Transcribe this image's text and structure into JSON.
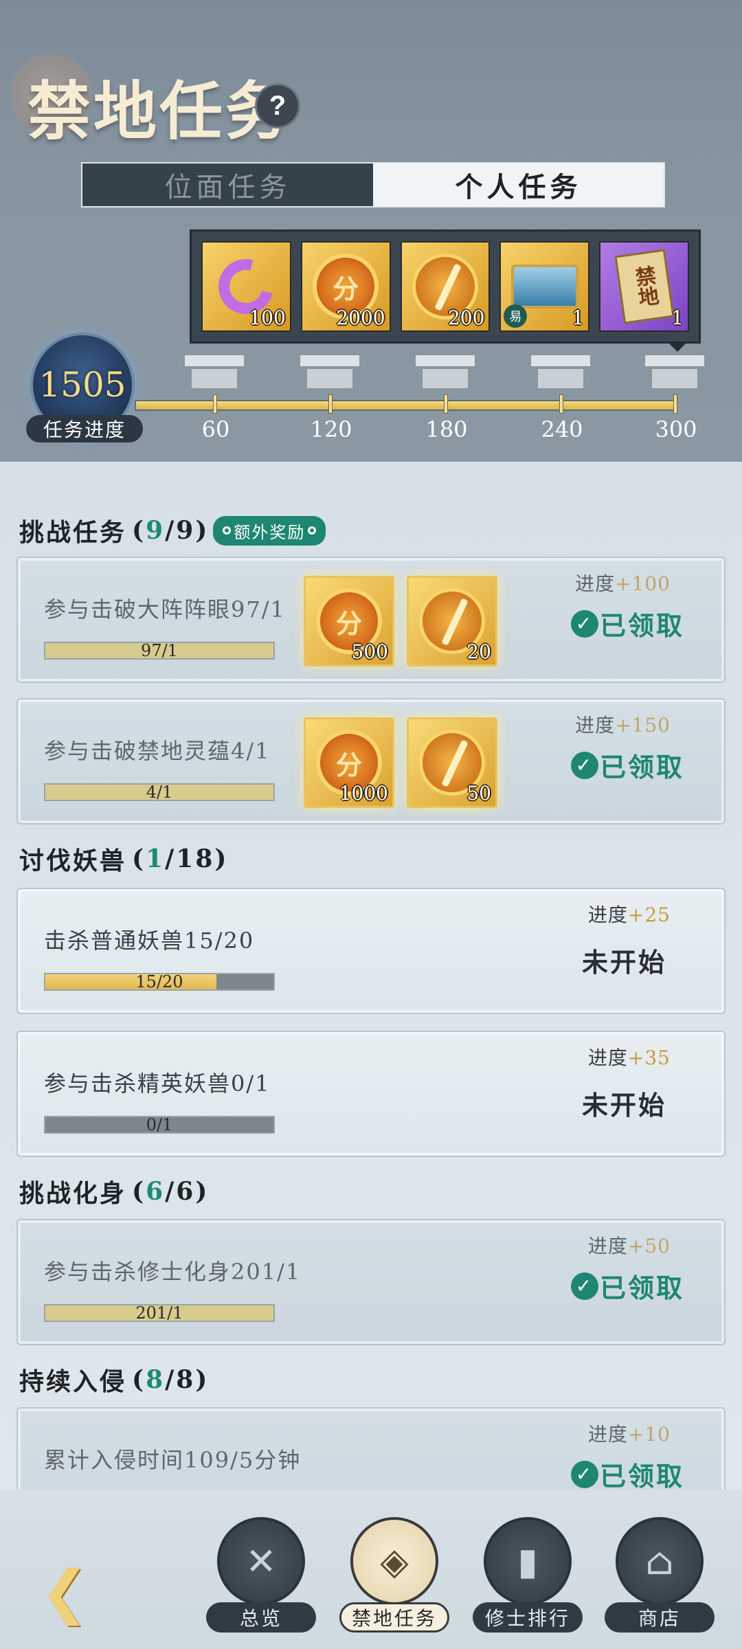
{
  "header": {
    "title": "禁地任务",
    "help": "?",
    "tabs": [
      {
        "label": "位面任务",
        "active": false
      },
      {
        "label": "个人任务",
        "active": true
      }
    ]
  },
  "rewards": [
    {
      "icon": "jade-icon",
      "count": "100"
    },
    {
      "icon": "score-coin-icon",
      "glyph": "分",
      "count": "2000"
    },
    {
      "icon": "sword-coin-icon",
      "count": "200"
    },
    {
      "icon": "treasure-chest-icon",
      "badge": "易",
      "count": "1"
    },
    {
      "icon": "scroll-icon",
      "glyph": "禁地",
      "count": "1"
    }
  ],
  "progress": {
    "value": "1505",
    "label": "任务进度",
    "fill_fraction": 1.0,
    "milestones": [
      "60",
      "120",
      "180",
      "240",
      "300"
    ]
  },
  "sections": [
    {
      "title": "挑战任务",
      "open": "(",
      "current": "9",
      "total": "/9",
      "close": ")",
      "extra_badge": "额外奖励",
      "tasks": [
        {
          "name": "参与击破大阵阵眼97/1",
          "bar_text": "97/1",
          "fill": 1.0,
          "progress_label": "进度",
          "progress_plus": "+100",
          "status": "已领取",
          "rewards": [
            {
              "glyph": "分",
              "count": "500"
            },
            {
              "glyph": "",
              "count": "20"
            }
          ]
        },
        {
          "name": "参与击破禁地灵蕴4/1",
          "bar_text": "4/1",
          "fill": 1.0,
          "progress_label": "进度",
          "progress_plus": "+150",
          "status": "已领取",
          "rewards": [
            {
              "glyph": "分",
              "count": "1000"
            },
            {
              "glyph": "",
              "count": "50"
            }
          ]
        }
      ]
    },
    {
      "title": "讨伐妖兽",
      "open": "(",
      "current": "1",
      "total": "/18",
      "close": ")",
      "tasks": [
        {
          "name": "击杀普通妖兽15/20",
          "bar_text": "15/20",
          "fill": 0.75,
          "progress_label": "进度",
          "progress_plus": "+25",
          "status": "未开始"
        },
        {
          "name": "参与击杀精英妖兽0/1",
          "bar_text": "0/1",
          "fill": 0,
          "progress_label": "进度",
          "progress_plus": "+35",
          "status": "未开始"
        }
      ]
    },
    {
      "title": "挑战化身",
      "open": "(",
      "current": "6",
      "total": "/6",
      "close": ")",
      "tasks": [
        {
          "name": "参与击杀修士化身201/1",
          "bar_text": "201/1",
          "fill": 1.0,
          "progress_label": "进度",
          "progress_plus": "+50",
          "status": "已领取"
        }
      ]
    },
    {
      "title": "持续入侵",
      "open": "(",
      "current": "8",
      "total": "/8",
      "close": ")",
      "tasks": [
        {
          "name": "累计入侵时间109/5分钟",
          "progress_label": "进度",
          "progress_plus": "+10",
          "status": "已领取"
        }
      ]
    }
  ],
  "nav": {
    "back_icon": "back-arrow-icon",
    "items": [
      {
        "label": "总览",
        "icon": "overview-icon",
        "active": false
      },
      {
        "label": "禁地任务",
        "icon": "task-book-icon",
        "active": true
      },
      {
        "label": "修士排行",
        "icon": "ranking-icon",
        "active": false
      },
      {
        "label": "商店",
        "icon": "shop-icon",
        "active": false
      }
    ]
  }
}
